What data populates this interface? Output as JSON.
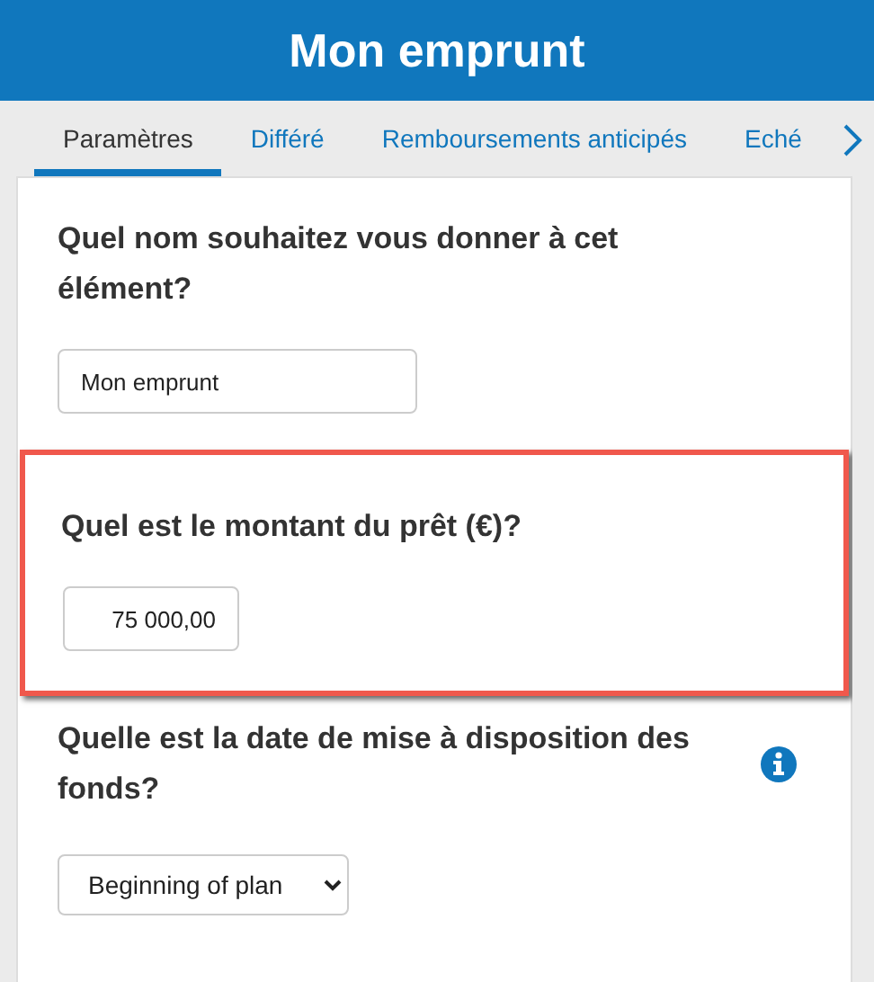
{
  "header": {
    "title": "Mon emprunt"
  },
  "tabs": [
    {
      "label": "Paramètres",
      "selected": true
    },
    {
      "label": "Différé",
      "selected": false
    },
    {
      "label": "Remboursements anticipés",
      "selected": false
    },
    {
      "label": "Eché",
      "selected": false
    }
  ],
  "questions": [
    {
      "label": "Quel nom souhaitez vous donner à cet élément?",
      "kind": "text",
      "value": "Mon emprunt",
      "highlighted": false,
      "info": false
    },
    {
      "label": "Quel est le montant du prêt (€)?",
      "kind": "number",
      "value": "75 000,00",
      "highlighted": true,
      "info": false
    },
    {
      "label": "Quelle est la date de mise à disposition des fonds?",
      "kind": "select",
      "value": "Beginning of plan",
      "highlighted": false,
      "info": true
    }
  ]
}
